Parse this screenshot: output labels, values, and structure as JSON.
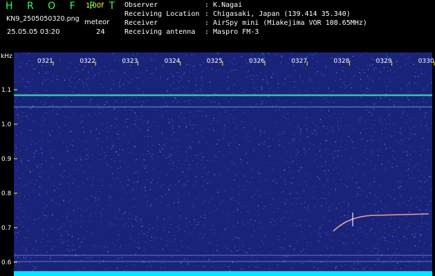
{
  "app": {
    "title": "H R O F F T",
    "version": "1.00f",
    "title_color": "#33ff66",
    "version_color": "#ffff33"
  },
  "file": {
    "name": "KN9_2505050320.png",
    "datetime": "25.05.05 03:20",
    "mode_label": "meteor",
    "mode_value": "24"
  },
  "info": [
    {
      "key": "Observer",
      "value": ": K.Nagai"
    },
    {
      "key": "Receiving Location",
      "value": ": Chigasaki, Japan (139.414 35.340)"
    },
    {
      "key": "Receiver",
      "value": ": AirSpy mini (Miakejima VOR 108.65MHz)"
    },
    {
      "key": "Receiving antenna",
      "value": ": Maspro FM-3"
    }
  ],
  "spectrogram": {
    "frequency_unit": "kHz",
    "y_ticks": [
      "1.1",
      "1.0",
      "0.9",
      "0.8",
      "0.7",
      "0.6"
    ],
    "time_labels": [
      "0321",
      "0322",
      "0323",
      "0324",
      "0325",
      "0326",
      "0327",
      "0328",
      "0329",
      "0330"
    ],
    "background_color": "#1a237a",
    "noise_color": "#4a6ad8",
    "carrier_color": "#44e0b0",
    "meteor_color": "#ffb0a0",
    "bottom_band_color": "#00e8ff",
    "label_color": "#ffffff",
    "tick_color": "#ffff00"
  }
}
